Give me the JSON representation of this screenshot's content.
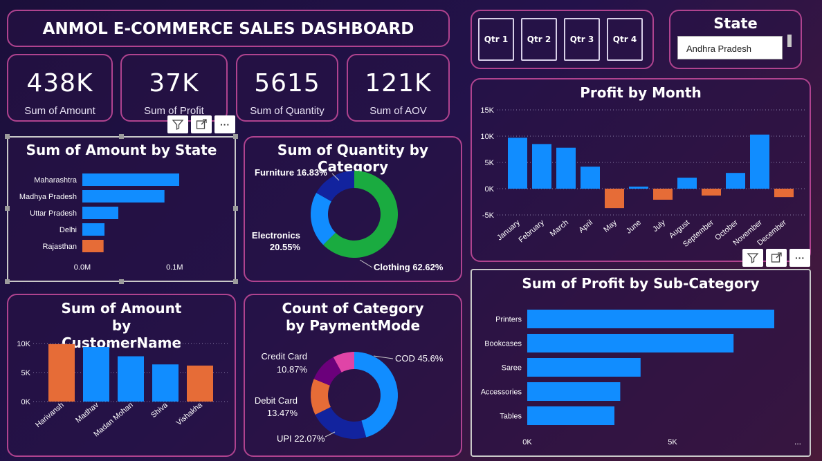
{
  "header": {
    "title": "ANMOL E-COMMERCE SALES DASHBOARD"
  },
  "quarters": [
    "Qtr 1",
    "Qtr 2",
    "Qtr 3",
    "Qtr 4"
  ],
  "state_slicer": {
    "title": "State",
    "selected": "Andhra Pradesh"
  },
  "kpis": [
    {
      "value": "438K",
      "label": "Sum of Amount"
    },
    {
      "value": "37K",
      "label": "Sum of Profit"
    },
    {
      "value": "5615",
      "label": "Sum of Quantity"
    },
    {
      "value": "121K",
      "label": "Sum of AOV"
    }
  ],
  "toolbar": {
    "more": "···"
  },
  "colors": {
    "blue": "#118dff",
    "orange": "#e66c37",
    "green": "#1aab40",
    "navy": "#12239e",
    "purple": "#6b007b",
    "pink": "#e044a7",
    "border": "#b0438f"
  },
  "chart_data": [
    {
      "id": "amount_by_state",
      "type": "bar",
      "orientation": "horizontal",
      "title": "Sum of Amount by State",
      "categories": [
        "Maharashtra",
        "Madhya Pradesh",
        "Uttar Pradesh",
        "Delhi",
        "Rajasthan"
      ],
      "values": [
        0.105,
        0.089,
        0.039,
        0.024,
        0.023
      ],
      "highlight": [
        "Rajasthan"
      ],
      "xticks": [
        "0.0M",
        "0.1M"
      ],
      "xlim": [
        0,
        0.12
      ]
    },
    {
      "id": "quantity_by_category",
      "type": "pie",
      "donut": true,
      "title": "Sum of Quantity by Category",
      "slices": [
        {
          "label": "Clothing",
          "pct": 62.62,
          "text": "Clothing 62.62%",
          "color": "#1aab40"
        },
        {
          "label": "Electronics",
          "pct": 20.55,
          "text": "Electronics 20.55%",
          "color": "#118dff"
        },
        {
          "label": "Furniture",
          "pct": 16.83,
          "text": "Furniture 16.83%",
          "color": "#12239e"
        }
      ]
    },
    {
      "id": "profit_by_month",
      "type": "bar",
      "title": "Profit by Month",
      "categories": [
        "January",
        "February",
        "March",
        "April",
        "May",
        "June",
        "July",
        "August",
        "September",
        "October",
        "November",
        "December"
      ],
      "values": [
        9700,
        8500,
        7800,
        4200,
        -3700,
        400,
        -2100,
        2100,
        -1300,
        3000,
        10300,
        -1600
      ],
      "yticks": [
        "15K",
        "10K",
        "5K",
        "0K",
        "-5K"
      ],
      "ylim": [
        -5000,
        15000
      ]
    },
    {
      "id": "amount_by_customer",
      "type": "bar",
      "title": "Sum of Amount by CustomerName",
      "categories": [
        "Harivansh",
        "Madhav",
        "Madan Mohan",
        "Shiva",
        "Vishakha"
      ],
      "values": [
        9900,
        9400,
        7800,
        6400,
        6200
      ],
      "highlight": [
        "Harivansh",
        "Vishakha"
      ],
      "yticks": [
        "10K",
        "5K",
        "0K"
      ],
      "ylim": [
        0,
        10000
      ]
    },
    {
      "id": "category_by_paymentmode",
      "type": "pie",
      "donut": true,
      "title": "Count of Category by PaymentMode",
      "slices": [
        {
          "label": "COD",
          "pct": 45.6,
          "text": "COD 45.6%",
          "color": "#118dff"
        },
        {
          "label": "UPI",
          "pct": 22.07,
          "text": "UPI 22.07%",
          "color": "#12239e"
        },
        {
          "label": "Debit Card",
          "pct": 13.47,
          "text": "Debit Card 13.47%",
          "color": "#e66c37"
        },
        {
          "label": "Credit Card",
          "pct": 10.87,
          "text": "Credit Card 10.87%",
          "color": "#6b007b"
        },
        {
          "label": "",
          "pct": 7.99,
          "text": "",
          "color": "#e044a7"
        }
      ]
    },
    {
      "id": "profit_by_subcategory",
      "type": "bar",
      "orientation": "horizontal",
      "title": "Sum of Profit by Sub-Category",
      "categories": [
        "Printers",
        "Bookcases",
        "Saree",
        "Accessories",
        "Tables"
      ],
      "values": [
        8500,
        7100,
        3900,
        3200,
        3000
      ],
      "xticks": [
        "0K",
        "5K"
      ],
      "xlim": [
        0,
        10000
      ]
    }
  ]
}
